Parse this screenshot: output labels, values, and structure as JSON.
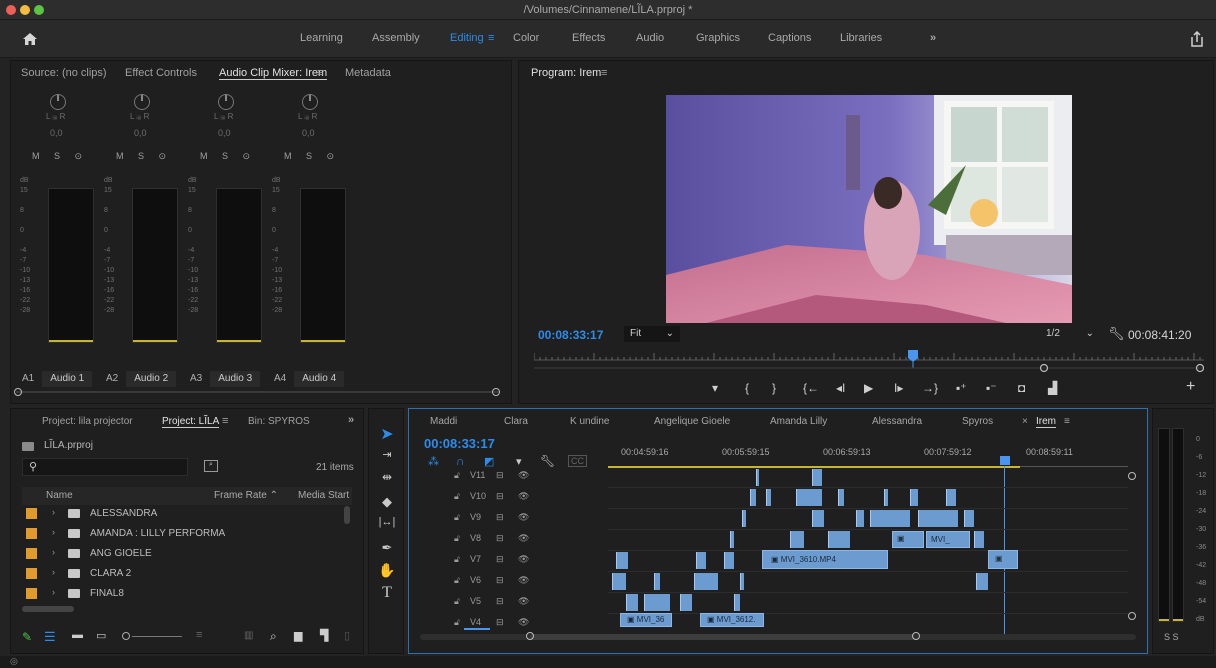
{
  "window": {
    "title": "/Volumes/Cinnamene/LĨLA.prproj *"
  },
  "workspaces": [
    "Learning",
    "Assembly",
    "Editing",
    "Color",
    "Effects",
    "Audio",
    "Graphics",
    "Captions",
    "Libraries"
  ],
  "workspace_active": "Editing",
  "source_panel": {
    "tabs": [
      "Source: (no clips)",
      "Effect Controls",
      "Audio Clip Mixer: Irem",
      "Metadata"
    ],
    "active_tab": "Audio Clip Mixer: Irem",
    "channels": [
      {
        "id": "A1",
        "name": "Audio 1",
        "pan_value": "0,0"
      },
      {
        "id": "A2",
        "name": "Audio 2",
        "pan_value": "0,0"
      },
      {
        "id": "A3",
        "name": "Audio 3",
        "pan_value": "0,0"
      },
      {
        "id": "A4",
        "name": "Audio 4",
        "pan_value": "0,0"
      }
    ],
    "pan_label": "L ᵢᵢᵢᵢ R",
    "msr": "M S ⊙",
    "db_label": "dB",
    "db_scale": [
      "15",
      "8",
      "0",
      "-4",
      "-7",
      "-10",
      "-13",
      "-16",
      "-22",
      "-28",
      "-∞"
    ]
  },
  "program_monitor": {
    "title": "Program: Irem",
    "timecode_current": "00:08:33:17",
    "timecode_duration": "00:08:41:20",
    "fit": "Fit",
    "resolution": "1/2",
    "transport_buttons": [
      "marker-icon",
      "mark-in-icon",
      "mark-out-icon",
      "go-to-in-icon",
      "step-back-icon",
      "play-icon",
      "step-forward-icon",
      "go-to-out-icon",
      "lift-icon",
      "extract-icon",
      "export-frame-icon",
      "comparison-icon",
      "add-button-icon"
    ]
  },
  "project_panel": {
    "tabs": [
      "Project: lila projector",
      "Project: LĨLA",
      "Bin: SPYROS"
    ],
    "active_tab": "Project: LĨLA",
    "project_file": "LĨLA.prproj",
    "search_placeholder": "",
    "item_count": "21 items",
    "columns": [
      "Name",
      "Frame Rate ⌃",
      "Media Start"
    ],
    "items": [
      "ALESSANDRA",
      "AMANDA : LILLY PERFORMA",
      "ANG GIOELE",
      "CLARA 2",
      "FINAL8"
    ]
  },
  "timeline": {
    "tabs": [
      "Maddi",
      "Clara",
      "K undine",
      "Angelique Gioele",
      "Amanda Lilly",
      "Alessandra",
      "Spyros",
      "Irem"
    ],
    "active_tab": "Irem",
    "timecode": "00:08:33:17",
    "ruler": [
      "00:04:59:16",
      "00:05:59:15",
      "00:06:59:13",
      "00:07:59:12",
      "00:08:59:11"
    ],
    "tracks": [
      "V11",
      "V10",
      "V9",
      "V8",
      "V7",
      "V6",
      "V5",
      "V4"
    ],
    "clip_labels": [
      "MVI_3610.MP4",
      "MVI_",
      "MVI_36",
      "MVI_3612."
    ]
  },
  "audio_meter": {
    "scale": [
      "0",
      "-6",
      "-12",
      "-18",
      "-24",
      "-30",
      "-36",
      "-42",
      "-48",
      "-54",
      "dB"
    ],
    "solo": "S S"
  },
  "colors": {
    "accent": "#2d8ceb",
    "clip": "#6c9bd0",
    "label": "#e19b2c",
    "playhead": "#4a95ef",
    "meter_level": "#c7b52f"
  }
}
